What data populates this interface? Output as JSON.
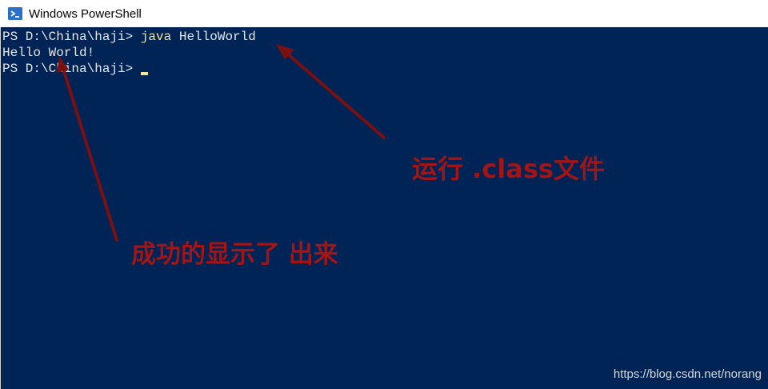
{
  "window": {
    "title": "Windows PowerShell",
    "icon": "powershell-icon",
    "background_color": "#012456"
  },
  "console": {
    "line1": {
      "prompt": "PS D:\\China\\haji> ",
      "command": "java",
      "args": " HelloWorld"
    },
    "line2": {
      "output": "Hello World!"
    },
    "line3": {
      "prompt": "PS D:\\China\\haji> "
    }
  },
  "annotations": {
    "run_class": "运行 .class文件",
    "shown_success": "成功的显示了 出来",
    "color": "#a31515"
  },
  "watermark": "https://blog.csdn.net/norang"
}
